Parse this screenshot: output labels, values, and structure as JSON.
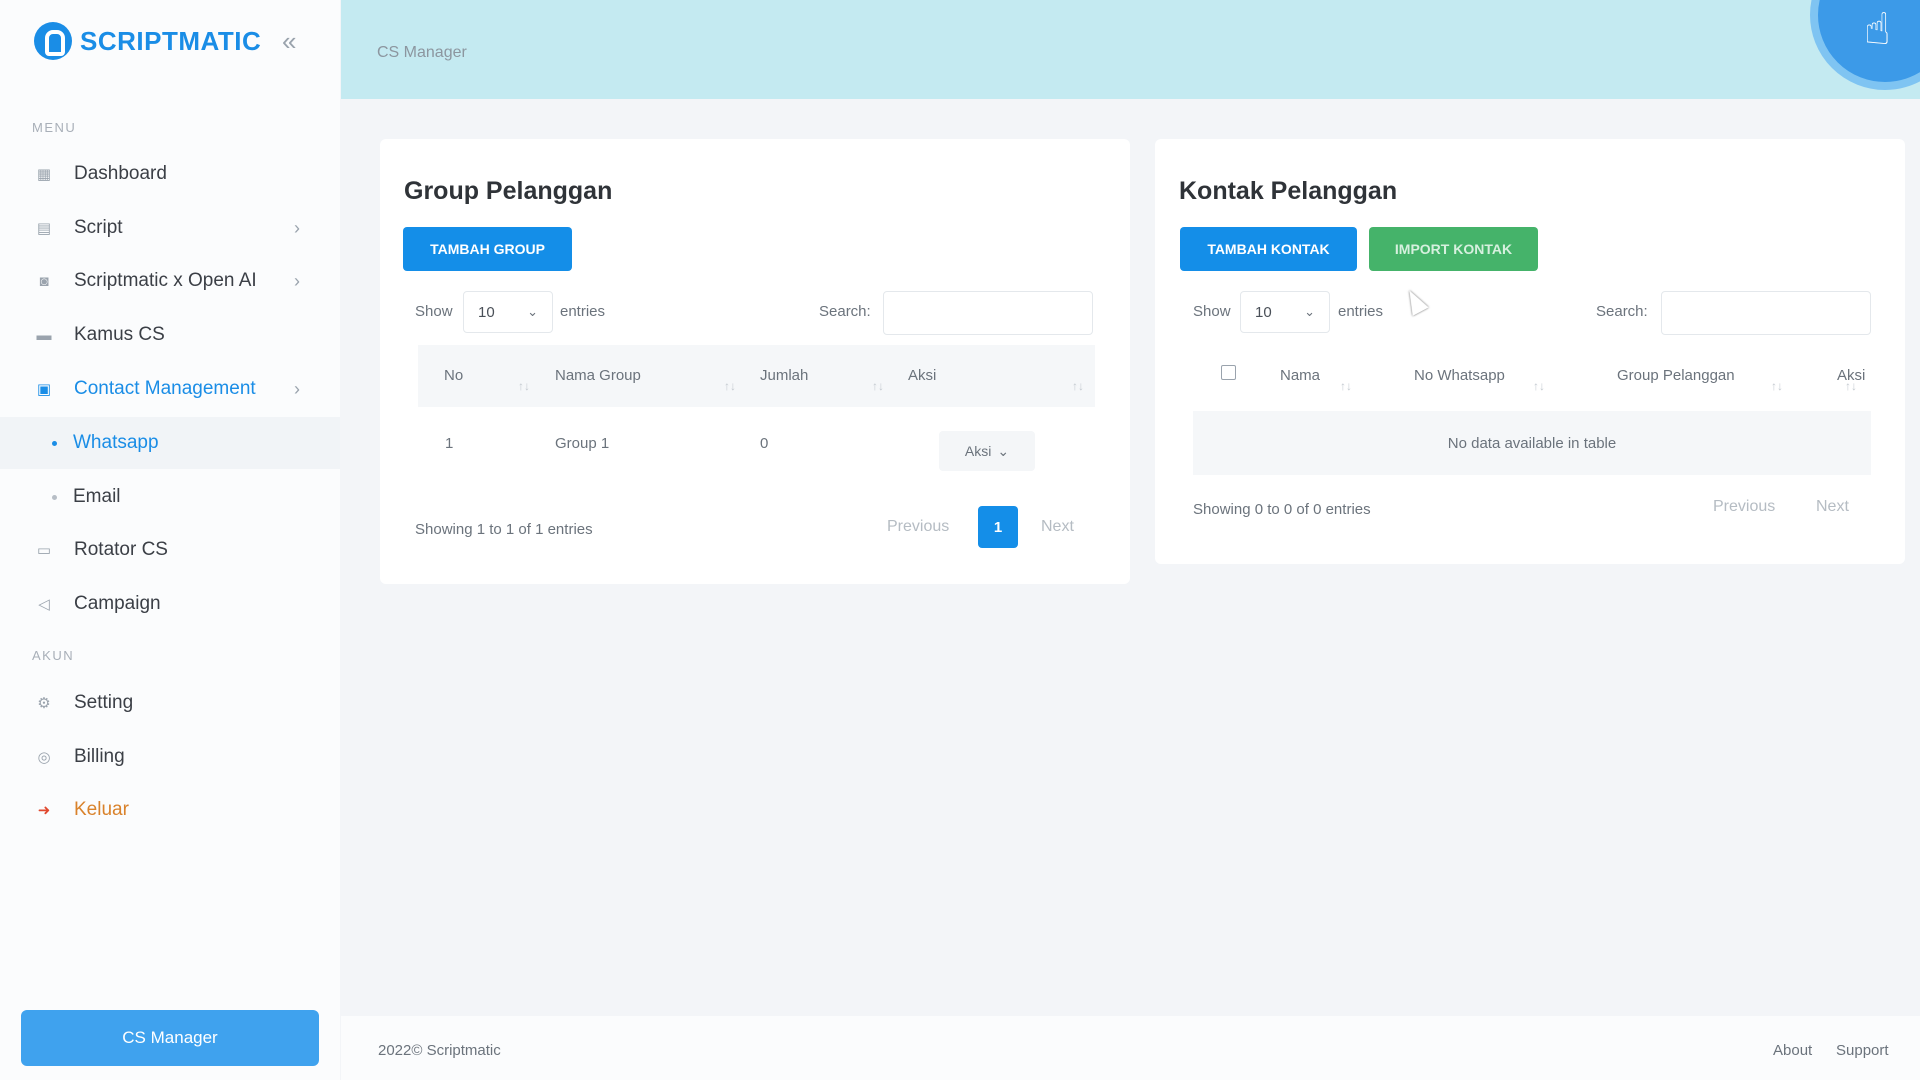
{
  "brand": {
    "name": "SCRIPTMATIC"
  },
  "sidebar": {
    "section_menu": "MENU",
    "section_akun": "AKUN",
    "items": [
      {
        "label": "Dashboard",
        "icon": "dashboard-icon"
      },
      {
        "label": "Script",
        "icon": "script-icon"
      },
      {
        "label": "Scriptmatic x Open AI",
        "icon": "robot-icon"
      },
      {
        "label": "Kamus CS",
        "icon": "book-icon"
      },
      {
        "label": "Contact Management",
        "icon": "contacts-icon"
      },
      {
        "label": "Whatsapp"
      },
      {
        "label": "Email"
      },
      {
        "label": "Rotator CS",
        "icon": "rotator-icon"
      },
      {
        "label": "Campaign",
        "icon": "megaphone-icon"
      },
      {
        "label": "Setting",
        "icon": "gear-icon"
      },
      {
        "label": "Billing",
        "icon": "billing-icon"
      },
      {
        "label": "Keluar",
        "icon": "logout-icon"
      }
    ],
    "footer_button": "CS Manager"
  },
  "header": {
    "breadcrumb": "CS Manager"
  },
  "group_card": {
    "title": "Group Pelanggan",
    "add_button": "TAMBAH GROUP",
    "show_label": "Show",
    "entries_value": "10",
    "entries_label": "entries",
    "search_label": "Search:",
    "columns": [
      "No",
      "Nama Group",
      "Jumlah",
      "Aksi"
    ],
    "rows": [
      {
        "no": "1",
        "nama_group": "Group 1",
        "jumlah": "0",
        "aksi": "Aksi"
      }
    ],
    "info": "Showing 1 to 1 of 1 entries",
    "previous": "Previous",
    "page": "1",
    "next": "Next"
  },
  "kontak_card": {
    "title": "Kontak Pelanggan",
    "add_button": "TAMBAH KONTAK",
    "import_button": "IMPORT KONTAK",
    "show_label": "Show",
    "entries_value": "10",
    "entries_label": "entries",
    "search_label": "Search:",
    "columns": [
      "Nama",
      "No Whatsapp",
      "Group Pelanggan",
      "Aksi"
    ],
    "empty_message": "No data available in table",
    "info": "Showing 0 to 0 of 0 entries",
    "previous": "Previous",
    "next": "Next"
  },
  "footer": {
    "copyright": "2022© Scriptmatic",
    "about": "About",
    "support": "Support"
  },
  "colors": {
    "primary": "#148ee8",
    "success": "#45b36a",
    "header_bg": "#c4eaf1",
    "danger": "#e0492f"
  }
}
